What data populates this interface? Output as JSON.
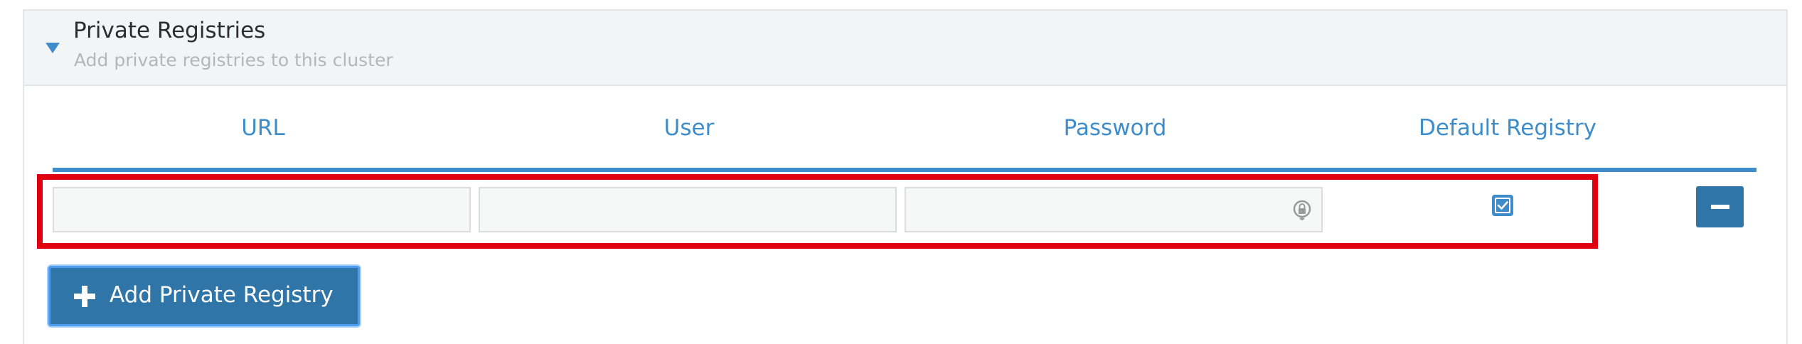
{
  "section": {
    "title": "Private Registries",
    "subtitle": "Add private registries to this cluster",
    "expanded": true
  },
  "table": {
    "columns": [
      "URL",
      "User",
      "Password",
      "Default Registry"
    ],
    "rows": [
      {
        "url": "",
        "user": "",
        "password": "",
        "default_registry": true
      }
    ]
  },
  "actions": {
    "add_label": "Add Private Registry",
    "remove_icon": "minus-icon",
    "add_icon": "plus-icon",
    "reveal_icon": "password-reveal-icon"
  },
  "colors": {
    "accent": "#3e8cc9",
    "button": "#2f75a8",
    "highlight": "#e0000f"
  }
}
